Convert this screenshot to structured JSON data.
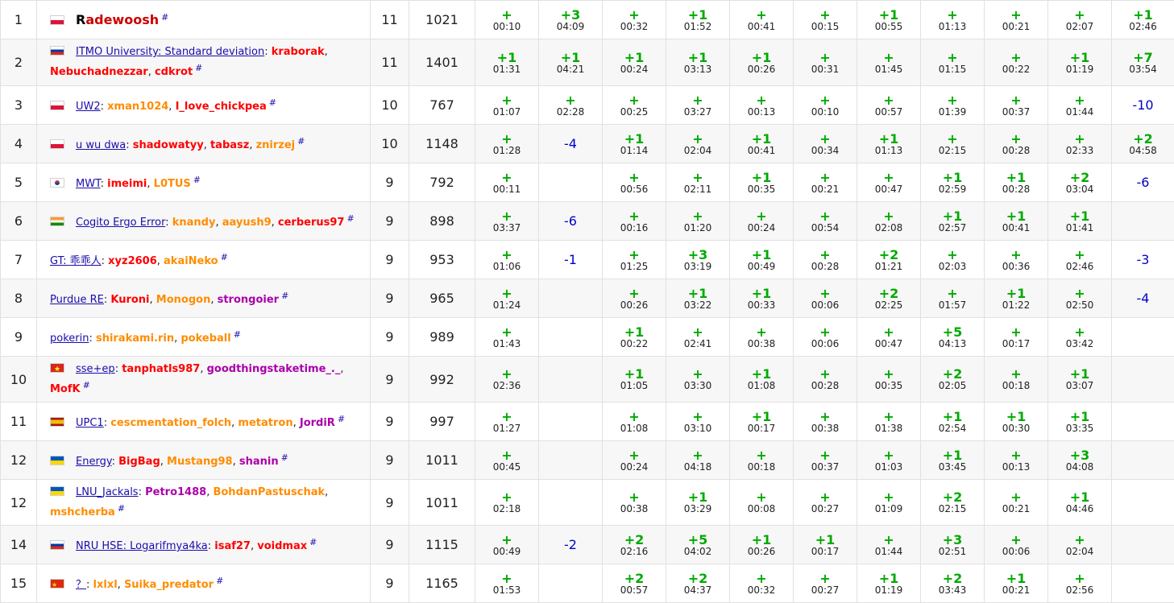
{
  "colors": {
    "ok": "#00aa00",
    "rejected": "#0000cc",
    "link": "#1a0dab",
    "row_alt": "#f7f7f7",
    "border": "#e1e1e1"
  },
  "hash": "#",
  "rows": [
    {
      "rank": "1",
      "flag": "pl",
      "team": "",
      "members": [
        {
          "name": "Radewoosh",
          "color": "#cc0000",
          "first_black": true
        }
      ],
      "solved": "11",
      "penalty": "1021",
      "problems": [
        {
          "r": "+",
          "t": "00:10"
        },
        {
          "r": "+3",
          "t": "04:09"
        },
        {
          "r": "+",
          "t": "00:32"
        },
        {
          "r": "+1",
          "t": "01:52"
        },
        {
          "r": "+",
          "t": "00:41"
        },
        {
          "r": "+",
          "t": "00:15"
        },
        {
          "r": "+1",
          "t": "00:55"
        },
        {
          "r": "+",
          "t": "01:13"
        },
        {
          "r": "+",
          "t": "00:21"
        },
        {
          "r": "+",
          "t": "02:07"
        },
        {
          "r": "+1",
          "t": "02:46"
        }
      ]
    },
    {
      "rank": "2",
      "flag": "ru",
      "team": "ITMO University: Standard deviation",
      "members": [
        {
          "name": "kraborak",
          "color": "#ff0000"
        },
        {
          "name": "Nebuchadnezzar",
          "color": "#ff0000"
        },
        {
          "name": "cdkrot",
          "color": "#ff0000"
        }
      ],
      "solved": "11",
      "penalty": "1401",
      "problems": [
        {
          "r": "+1",
          "t": "01:31"
        },
        {
          "r": "+1",
          "t": "04:21"
        },
        {
          "r": "+1",
          "t": "00:24"
        },
        {
          "r": "+1",
          "t": "03:13"
        },
        {
          "r": "+1",
          "t": "00:26"
        },
        {
          "r": "+",
          "t": "00:31"
        },
        {
          "r": "+",
          "t": "01:45"
        },
        {
          "r": "+",
          "t": "01:15"
        },
        {
          "r": "+",
          "t": "00:22"
        },
        {
          "r": "+1",
          "t": "01:19"
        },
        {
          "r": "+7",
          "t": "03:54"
        }
      ]
    },
    {
      "rank": "3",
      "flag": "pl",
      "team": "UW2",
      "members": [
        {
          "name": "xman1024",
          "color": "#ff8c00"
        },
        {
          "name": "I_love_chickpea",
          "color": "#ff0000"
        }
      ],
      "solved": "10",
      "penalty": "767",
      "problems": [
        {
          "r": "+",
          "t": "01:07"
        },
        {
          "r": "+",
          "t": "02:28"
        },
        {
          "r": "+",
          "t": "00:25"
        },
        {
          "r": "+",
          "t": "03:27"
        },
        {
          "r": "+",
          "t": "00:13"
        },
        {
          "r": "+",
          "t": "00:10"
        },
        {
          "r": "+",
          "t": "00:57"
        },
        {
          "r": "+",
          "t": "01:39"
        },
        {
          "r": "+",
          "t": "00:37"
        },
        {
          "r": "+",
          "t": "01:44"
        },
        {
          "r": "-10",
          "t": ""
        }
      ]
    },
    {
      "rank": "4",
      "flag": "pl",
      "team": "u wu dwa",
      "members": [
        {
          "name": "shadowatyy",
          "color": "#ff0000"
        },
        {
          "name": "tabasz",
          "color": "#ff0000"
        },
        {
          "name": "znirzej",
          "color": "#ff8c00"
        }
      ],
      "solved": "10",
      "penalty": "1148",
      "problems": [
        {
          "r": "+",
          "t": "01:28"
        },
        {
          "r": "-4",
          "t": ""
        },
        {
          "r": "+1",
          "t": "01:14"
        },
        {
          "r": "+",
          "t": "02:04"
        },
        {
          "r": "+1",
          "t": "00:41"
        },
        {
          "r": "+",
          "t": "00:34"
        },
        {
          "r": "+1",
          "t": "01:13"
        },
        {
          "r": "+",
          "t": "02:15"
        },
        {
          "r": "+",
          "t": "00:28"
        },
        {
          "r": "+",
          "t": "02:33"
        },
        {
          "r": "+2",
          "t": "04:58"
        }
      ]
    },
    {
      "rank": "5",
      "flag": "kr",
      "team": "MWT",
      "members": [
        {
          "name": "imeimi",
          "color": "#ff0000"
        },
        {
          "name": "L0TUS",
          "color": "#ff8c00"
        }
      ],
      "solved": "9",
      "penalty": "792",
      "problems": [
        {
          "r": "+",
          "t": "00:11"
        },
        {
          "r": "",
          "t": ""
        },
        {
          "r": "+",
          "t": "00:56"
        },
        {
          "r": "+",
          "t": "02:11"
        },
        {
          "r": "+1",
          "t": "00:35"
        },
        {
          "r": "+",
          "t": "00:21"
        },
        {
          "r": "+",
          "t": "00:47"
        },
        {
          "r": "+1",
          "t": "02:59"
        },
        {
          "r": "+1",
          "t": "00:28"
        },
        {
          "r": "+2",
          "t": "03:04"
        },
        {
          "r": "-6",
          "t": ""
        }
      ]
    },
    {
      "rank": "6",
      "flag": "in",
      "team": "Cogito Ergo Error",
      "members": [
        {
          "name": "knandy",
          "color": "#ff8c00"
        },
        {
          "name": "aayush9",
          "color": "#ff8c00"
        },
        {
          "name": "cerberus97",
          "color": "#ff0000"
        }
      ],
      "solved": "9",
      "penalty": "898",
      "problems": [
        {
          "r": "+",
          "t": "03:37"
        },
        {
          "r": "-6",
          "t": ""
        },
        {
          "r": "+",
          "t": "00:16"
        },
        {
          "r": "+",
          "t": "01:20"
        },
        {
          "r": "+",
          "t": "00:24"
        },
        {
          "r": "+",
          "t": "00:54"
        },
        {
          "r": "+",
          "t": "02:08"
        },
        {
          "r": "+1",
          "t": "02:57"
        },
        {
          "r": "+1",
          "t": "00:41"
        },
        {
          "r": "+1",
          "t": "01:41"
        },
        {
          "r": "",
          "t": ""
        }
      ]
    },
    {
      "rank": "7",
      "flag": "",
      "team": "GT: 乖乖人",
      "members": [
        {
          "name": "xyz2606",
          "color": "#ff0000"
        },
        {
          "name": "akaiNeko",
          "color": "#ff8c00"
        }
      ],
      "solved": "9",
      "penalty": "953",
      "problems": [
        {
          "r": "+",
          "t": "01:06"
        },
        {
          "r": "-1",
          "t": ""
        },
        {
          "r": "+",
          "t": "01:25"
        },
        {
          "r": "+3",
          "t": "03:19"
        },
        {
          "r": "+1",
          "t": "00:49"
        },
        {
          "r": "+",
          "t": "00:28"
        },
        {
          "r": "+2",
          "t": "01:21"
        },
        {
          "r": "+",
          "t": "02:03"
        },
        {
          "r": "+",
          "t": "00:36"
        },
        {
          "r": "+",
          "t": "02:46"
        },
        {
          "r": "-3",
          "t": ""
        }
      ]
    },
    {
      "rank": "8",
      "flag": "",
      "team": "Purdue RE",
      "members": [
        {
          "name": "Kuroni",
          "color": "#ff0000"
        },
        {
          "name": "Monogon",
          "color": "#ff8c00"
        },
        {
          "name": "strongoier",
          "color": "#aa00aa"
        }
      ],
      "solved": "9",
      "penalty": "965",
      "problems": [
        {
          "r": "+",
          "t": "01:24"
        },
        {
          "r": "",
          "t": ""
        },
        {
          "r": "+",
          "t": "00:26"
        },
        {
          "r": "+1",
          "t": "03:22"
        },
        {
          "r": "+1",
          "t": "00:33"
        },
        {
          "r": "+",
          "t": "00:06"
        },
        {
          "r": "+2",
          "t": "02:25"
        },
        {
          "r": "+",
          "t": "01:57"
        },
        {
          "r": "+1",
          "t": "01:22"
        },
        {
          "r": "+",
          "t": "02:50"
        },
        {
          "r": "-4",
          "t": ""
        }
      ]
    },
    {
      "rank": "9",
      "flag": "",
      "team": "pokerin",
      "members": [
        {
          "name": "shirakami.rin",
          "color": "#ff8c00"
        },
        {
          "name": "pokeball",
          "color": "#ff8c00"
        }
      ],
      "solved": "9",
      "penalty": "989",
      "problems": [
        {
          "r": "+",
          "t": "01:43"
        },
        {
          "r": "",
          "t": ""
        },
        {
          "r": "+1",
          "t": "00:22"
        },
        {
          "r": "+",
          "t": "02:41"
        },
        {
          "r": "+",
          "t": "00:38"
        },
        {
          "r": "+",
          "t": "00:06"
        },
        {
          "r": "+",
          "t": "00:47"
        },
        {
          "r": "+5",
          "t": "04:13"
        },
        {
          "r": "+",
          "t": "00:17"
        },
        {
          "r": "+",
          "t": "03:42"
        },
        {
          "r": "",
          "t": ""
        }
      ]
    },
    {
      "rank": "10",
      "flag": "vn",
      "team": "sse+ep",
      "members": [
        {
          "name": "tanphatls987",
          "color": "#ff0000"
        },
        {
          "name": "goodthingstaketime_._",
          "color": "#aa00aa"
        },
        {
          "name": "MofK",
          "color": "#ff0000"
        }
      ],
      "solved": "9",
      "penalty": "992",
      "problems": [
        {
          "r": "+",
          "t": "02:36"
        },
        {
          "r": "",
          "t": ""
        },
        {
          "r": "+1",
          "t": "01:05"
        },
        {
          "r": "+",
          "t": "03:30"
        },
        {
          "r": "+1",
          "t": "01:08"
        },
        {
          "r": "+",
          "t": "00:28"
        },
        {
          "r": "+",
          "t": "00:35"
        },
        {
          "r": "+2",
          "t": "02:05"
        },
        {
          "r": "+",
          "t": "00:18"
        },
        {
          "r": "+1",
          "t": "03:07"
        },
        {
          "r": "",
          "t": ""
        }
      ]
    },
    {
      "rank": "11",
      "flag": "es",
      "team": "UPC1",
      "members": [
        {
          "name": "cescmentation_folch",
          "color": "#ff8c00"
        },
        {
          "name": "metatron",
          "color": "#ff8c00"
        },
        {
          "name": "JordiR",
          "color": "#aa00aa"
        }
      ],
      "solved": "9",
      "penalty": "997",
      "problems": [
        {
          "r": "+",
          "t": "01:27"
        },
        {
          "r": "",
          "t": ""
        },
        {
          "r": "+",
          "t": "01:08"
        },
        {
          "r": "+",
          "t": "03:10"
        },
        {
          "r": "+1",
          "t": "00:17"
        },
        {
          "r": "+",
          "t": "00:38"
        },
        {
          "r": "+",
          "t": "01:38"
        },
        {
          "r": "+1",
          "t": "02:54"
        },
        {
          "r": "+1",
          "t": "00:30"
        },
        {
          "r": "+1",
          "t": "03:35"
        },
        {
          "r": "",
          "t": ""
        }
      ]
    },
    {
      "rank": "12",
      "flag": "ua",
      "team": "Energy",
      "members": [
        {
          "name": "BigBag",
          "color": "#ff0000"
        },
        {
          "name": "Mustang98",
          "color": "#ff8c00"
        },
        {
          "name": "shanin",
          "color": "#aa00aa"
        }
      ],
      "solved": "9",
      "penalty": "1011",
      "problems": [
        {
          "r": "+",
          "t": "00:45"
        },
        {
          "r": "",
          "t": ""
        },
        {
          "r": "+",
          "t": "00:24"
        },
        {
          "r": "+",
          "t": "04:18"
        },
        {
          "r": "+",
          "t": "00:18"
        },
        {
          "r": "+",
          "t": "00:37"
        },
        {
          "r": "+",
          "t": "01:03"
        },
        {
          "r": "+1",
          "t": "03:45"
        },
        {
          "r": "+",
          "t": "00:13"
        },
        {
          "r": "+3",
          "t": "04:08"
        },
        {
          "r": "",
          "t": ""
        }
      ]
    },
    {
      "rank": "12",
      "flag": "ua",
      "team": "LNU_Jackals",
      "members": [
        {
          "name": "Petro1488",
          "color": "#aa00aa"
        },
        {
          "name": "BohdanPastuschak",
          "color": "#ff8c00"
        },
        {
          "name": "mshcherba",
          "color": "#ff8c00"
        }
      ],
      "solved": "9",
      "penalty": "1011",
      "problems": [
        {
          "r": "+",
          "t": "02:18"
        },
        {
          "r": "",
          "t": ""
        },
        {
          "r": "+",
          "t": "00:38"
        },
        {
          "r": "+1",
          "t": "03:29"
        },
        {
          "r": "+",
          "t": "00:08"
        },
        {
          "r": "+",
          "t": "00:27"
        },
        {
          "r": "+",
          "t": "01:09"
        },
        {
          "r": "+2",
          "t": "02:15"
        },
        {
          "r": "+",
          "t": "00:21"
        },
        {
          "r": "+1",
          "t": "04:46"
        },
        {
          "r": "",
          "t": ""
        }
      ]
    },
    {
      "rank": "14",
      "flag": "ru",
      "team": "NRU HSE: Logarifmya4ka",
      "members": [
        {
          "name": "isaf27",
          "color": "#ff0000"
        },
        {
          "name": "voidmax",
          "color": "#ff0000"
        }
      ],
      "solved": "9",
      "penalty": "1115",
      "problems": [
        {
          "r": "+",
          "t": "00:49"
        },
        {
          "r": "-2",
          "t": ""
        },
        {
          "r": "+2",
          "t": "02:16"
        },
        {
          "r": "+5",
          "t": "04:02"
        },
        {
          "r": "+1",
          "t": "00:26"
        },
        {
          "r": "+1",
          "t": "00:17"
        },
        {
          "r": "+",
          "t": "01:44"
        },
        {
          "r": "+3",
          "t": "02:51"
        },
        {
          "r": "+",
          "t": "00:06"
        },
        {
          "r": "+",
          "t": "02:04"
        },
        {
          "r": "",
          "t": ""
        }
      ]
    },
    {
      "rank": "15",
      "flag": "cn",
      "team": "？",
      "members": [
        {
          "name": "lxlxl",
          "color": "#ff8c00"
        },
        {
          "name": "Suika_predator",
          "color": "#ff8c00"
        }
      ],
      "solved": "9",
      "penalty": "1165",
      "problems": [
        {
          "r": "+",
          "t": "01:53"
        },
        {
          "r": "",
          "t": ""
        },
        {
          "r": "+2",
          "t": "00:57"
        },
        {
          "r": "+2",
          "t": "04:37"
        },
        {
          "r": "+",
          "t": "00:32"
        },
        {
          "r": "+",
          "t": "00:27"
        },
        {
          "r": "+1",
          "t": "01:19"
        },
        {
          "r": "+2",
          "t": "03:43"
        },
        {
          "r": "+1",
          "t": "00:21"
        },
        {
          "r": "+",
          "t": "02:56"
        },
        {
          "r": "",
          "t": ""
        }
      ]
    }
  ]
}
